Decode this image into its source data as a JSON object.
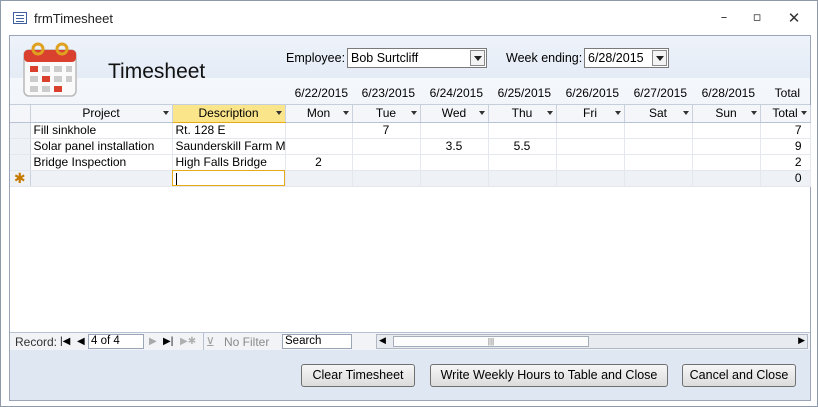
{
  "window": {
    "title": "frmTimesheet",
    "min": "–",
    "max": "▫",
    "close": "✕"
  },
  "header": {
    "title": "Timesheet",
    "employee_label": "Employee:",
    "employee_value": "Bob Surtcliff",
    "week_label": "Week ending:",
    "week_value": "6/28/2015",
    "dates": [
      "6/22/2015",
      "6/23/2015",
      "6/24/2015",
      "6/25/2015",
      "6/26/2015",
      "6/27/2015",
      "6/28/2015"
    ],
    "total_label": "Total"
  },
  "grid": {
    "columns": [
      "Project",
      "Description",
      "Mon",
      "Tue",
      "Wed",
      "Thu",
      "Fri",
      "Sat",
      "Sun",
      "Total"
    ],
    "rows": [
      {
        "project": "Fill sinkhole",
        "description": "Rt. 128 E",
        "mon": "",
        "tue": "7",
        "wed": "",
        "thu": "",
        "fri": "",
        "sat": "",
        "sun": "",
        "total": "7"
      },
      {
        "project": "Solar panel installation",
        "description": "Saunderskill Farm M",
        "mon": "",
        "tue": "",
        "wed": "3.5",
        "thu": "5.5",
        "fri": "",
        "sat": "",
        "sun": "",
        "total": "9"
      },
      {
        "project": "Bridge Inspection",
        "description": "High Falls Bridge",
        "mon": "2",
        "tue": "",
        "wed": "",
        "thu": "",
        "fri": "",
        "sat": "",
        "sun": "",
        "total": "2"
      }
    ],
    "new_row_marker": "✱",
    "new_row_total": "0"
  },
  "navigation": {
    "record_label": "Record:",
    "record_value": "4 of 4",
    "no_filter": "No Filter",
    "search": "Search",
    "thumb_grip": "|||"
  },
  "buttons": {
    "clear": "Clear Timesheet",
    "write": "Write Weekly Hours to Table and Close",
    "cancel": "Cancel and Close"
  }
}
